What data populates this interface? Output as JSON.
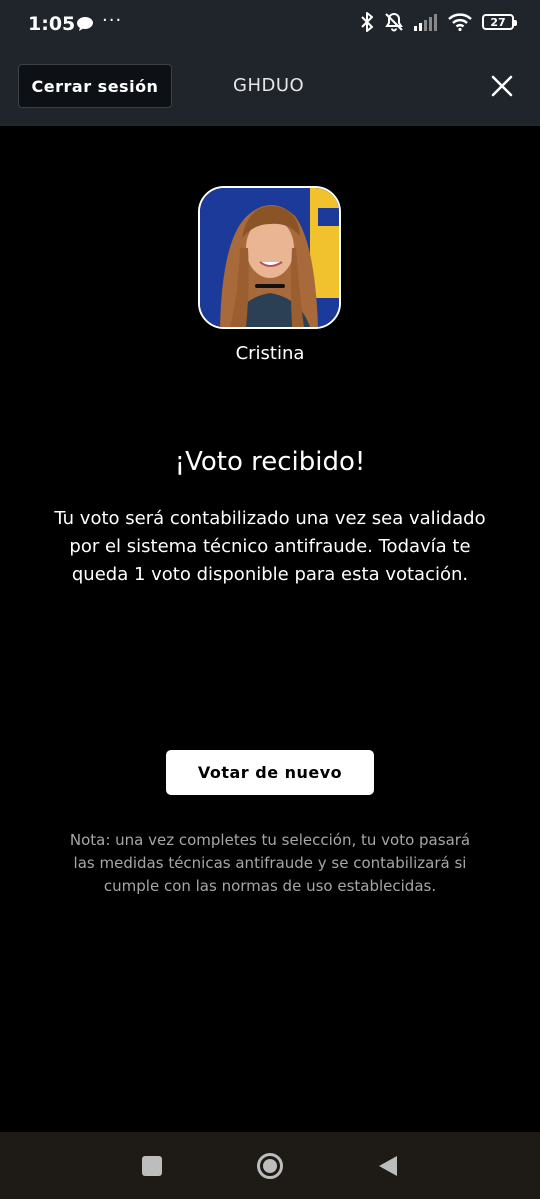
{
  "status_bar": {
    "time": "1:05",
    "more": "···",
    "battery": "27"
  },
  "header": {
    "logout_label": "Cerrar sesión",
    "title": "GHDUO"
  },
  "candidate": {
    "name": "Cristina"
  },
  "confirmation": {
    "heading": "¡Voto recibido!",
    "message": "Tu voto será contabilizado una vez sea validado por el sistema técnico antifraude. Todavía te queda 1 voto disponible para esta votación.",
    "vote_again_label": "Votar de nuevo",
    "note": "Nota: una vez completes tu selección, tu voto pasará las medidas técnicas antifraude y se contabilizará si cumple con las normas de uso establecidas."
  },
  "colors": {
    "background": "#000000",
    "header_bg": "#1f252a",
    "note_text": "#a6a6a6",
    "avatar_bg": "#1c3a9a",
    "avatar_accent": "#f2c12e"
  }
}
